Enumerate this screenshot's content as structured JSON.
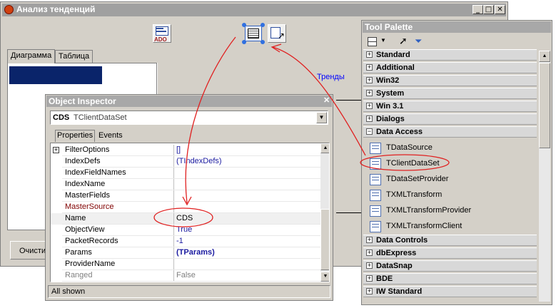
{
  "main_window": {
    "title": "Анализ тенденций",
    "tabs": [
      "Диаграмма",
      "Таблица"
    ],
    "trend_label": "Тренды",
    "clear_button": "Очисти",
    "icons": [
      "ado-component-icon",
      "clientdataset-component-icon",
      "datasetprovider-component-icon"
    ]
  },
  "object_inspector": {
    "title": "Object Inspector",
    "selector_name": "CDS",
    "selector_type": "TClientDataSet",
    "tabs": [
      "Properties",
      "Events"
    ],
    "status": "All shown",
    "properties": [
      {
        "name": "FilterOptions",
        "value": "[]",
        "expander": "+"
      },
      {
        "name": "IndexDefs",
        "value": "(TIndexDefs)",
        "expander": ""
      },
      {
        "name": "IndexFieldNames",
        "value": "",
        "expander": ""
      },
      {
        "name": "IndexName",
        "value": "",
        "expander": ""
      },
      {
        "name": "MasterFields",
        "value": "",
        "expander": ""
      },
      {
        "name": "MasterSource",
        "value": "",
        "expander": ""
      },
      {
        "name": "Name",
        "value": "CDS",
        "expander": ""
      },
      {
        "name": "ObjectView",
        "value": "True",
        "expander": ""
      },
      {
        "name": "PacketRecords",
        "value": "-1",
        "expander": ""
      },
      {
        "name": "Params",
        "value": "(TParams)",
        "expander": ""
      },
      {
        "name": "ProviderName",
        "value": "",
        "expander": ""
      },
      {
        "name": "Ranged",
        "value": "False",
        "expander": ""
      }
    ],
    "colors": {
      "link_value": "#1a1aa0",
      "master_source": "#800000",
      "disabled": "#808080"
    }
  },
  "tool_palette": {
    "title": "Tool Palette",
    "categories_top": [
      "Standard",
      "Additional",
      "Win32",
      "System",
      "Win 3.1",
      "Dialogs",
      "Data Access"
    ],
    "data_access_items": [
      "TDataSource",
      "TClientDataSet",
      "TDataSetProvider",
      "TXMLTransform",
      "TXMLTransformProvider",
      "TXMLTransformClient"
    ],
    "categories_bottom": [
      "Data Controls",
      "dbExpress",
      "DataSnap",
      "BDE",
      "IW Standard"
    ]
  },
  "annotation_color": "#e02020"
}
